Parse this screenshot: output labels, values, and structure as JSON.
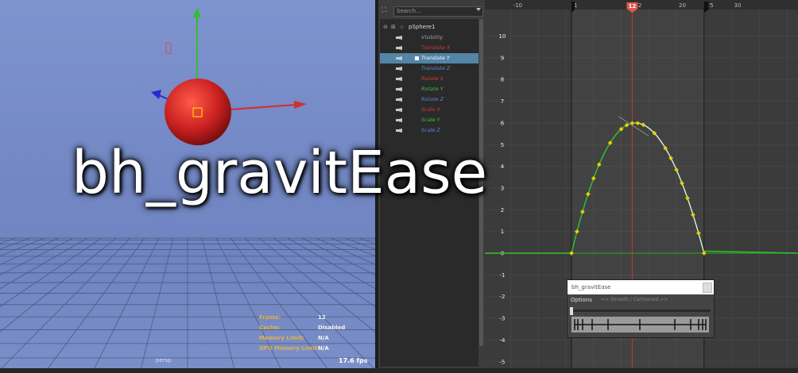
{
  "viewport": {
    "hud": [
      {
        "label": "Frame:",
        "value": "12"
      },
      {
        "label": "Cache:",
        "value": "Disabled"
      },
      {
        "label": "Memory Limit:",
        "value": "N/A"
      },
      {
        "label": "GPU Memory Limit:",
        "value": "N/A"
      }
    ],
    "camera": "persp",
    "fps": "17.6 fps"
  },
  "outliner": {
    "search_placeholder": "Search...",
    "node": "pSphere1",
    "attributes": [
      {
        "label": "Visibility",
        "color": "#a0a0a0"
      },
      {
        "label": "Translate X",
        "color": "#d33a3a"
      },
      {
        "label": "Translate Y",
        "color": "#ffffff"
      },
      {
        "label": "Translate Z",
        "color": "#5b86d6"
      },
      {
        "label": "Rotate X",
        "color": "#d33a3a"
      },
      {
        "label": "Rotate Y",
        "color": "#3fc23f"
      },
      {
        "label": "Rotate Z",
        "color": "#5b86d6"
      },
      {
        "label": "Scale X",
        "color": "#d33a3a"
      },
      {
        "label": "Scale Y",
        "color": "#3fc23f"
      },
      {
        "label": "Scale Z",
        "color": "#5b86d6"
      }
    ],
    "selected_index": 2
  },
  "graph": {
    "ruler_ticks": [
      "-10",
      "1",
      "12",
      "20",
      "25",
      "30"
    ],
    "current_frame": "12",
    "y_labels": [
      "10",
      "9",
      "8",
      "7",
      "6",
      "5",
      "4",
      "3",
      "2",
      "1",
      "0",
      "-1",
      "-2",
      "-3",
      "-4",
      "-5"
    ]
  },
  "title": "bh_gravitEase",
  "tool_window": {
    "title": "bh_gravitEase",
    "menu": "Options",
    "mode": "<< Smooth / Cartooned >>"
  }
}
